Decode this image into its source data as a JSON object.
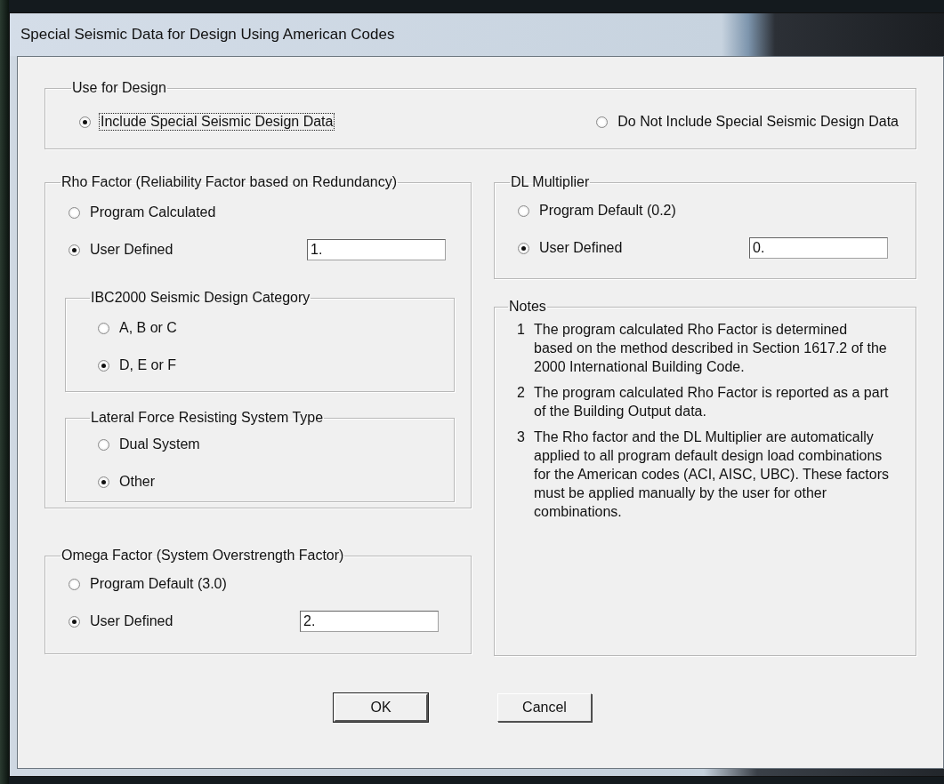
{
  "window": {
    "title": "Special Seismic Data for Design Using American Codes"
  },
  "use_for_design": {
    "label": "Use for Design",
    "options": [
      {
        "label": "Include Special Seismic Design Data",
        "selected": true,
        "focused": true
      },
      {
        "label": "Do Not Include Special Seismic Design Data",
        "selected": false,
        "focused": false
      }
    ]
  },
  "rho_factor": {
    "label": "Rho Factor (Reliability Factor based on Redundancy)",
    "options": [
      {
        "label": "Program Calculated",
        "selected": false
      },
      {
        "label": "User Defined",
        "selected": true,
        "value": "1."
      }
    ],
    "ibc_category": {
      "label": "IBC2000 Seismic Design Category",
      "options": [
        {
          "label": "A, B or C",
          "selected": false
        },
        {
          "label": "D, E or F",
          "selected": true
        }
      ]
    },
    "lateral_system": {
      "label": "Lateral Force Resisting System Type",
      "options": [
        {
          "label": "Dual System",
          "selected": false
        },
        {
          "label": "Other",
          "selected": true
        }
      ]
    }
  },
  "omega_factor": {
    "label": "Omega Factor (System Overstrength Factor)",
    "options": [
      {
        "label": "Program Default (3.0)",
        "selected": false
      },
      {
        "label": "User Defined",
        "selected": true,
        "value": "2."
      }
    ]
  },
  "dl_multiplier": {
    "label": "DL Multiplier",
    "options": [
      {
        "label": "Program Default (0.2)",
        "selected": false
      },
      {
        "label": "User Defined",
        "selected": true,
        "value": "0."
      }
    ]
  },
  "notes": {
    "label": "Notes",
    "items": [
      {
        "number": "1",
        "text": "The program calculated Rho Factor is determined based on the method described in Section 1617.2 of the 2000 International Building Code."
      },
      {
        "number": "2",
        "text": "The program calculated Rho Factor is reported as a part of the Building Output data."
      },
      {
        "number": "3",
        "text": "The Rho factor and the DL Multiplier are automatically applied to all program default design load combinations for the American codes (ACI, AISC, UBC).  These factors must be applied manually by the user for other combinations."
      }
    ]
  },
  "buttons": [
    {
      "label": "OK",
      "default": true
    },
    {
      "label": "Cancel",
      "default": false
    }
  ]
}
